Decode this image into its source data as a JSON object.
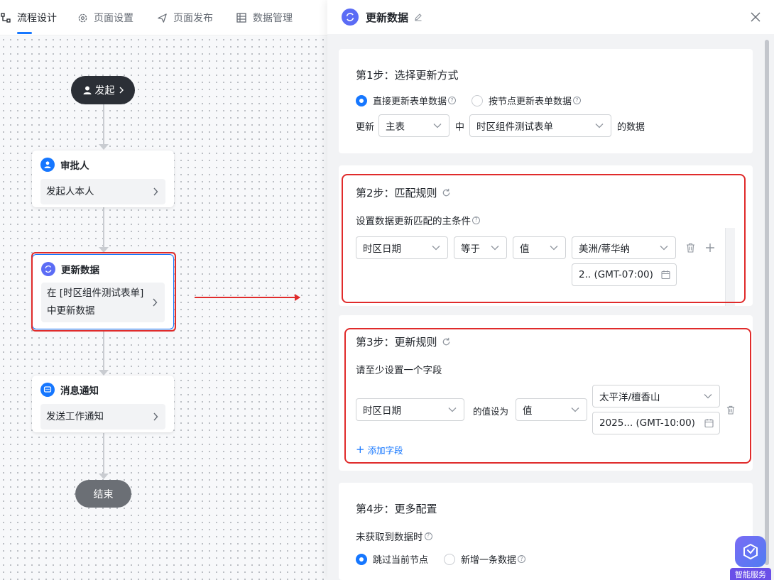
{
  "tabs": [
    {
      "label": "流程设计",
      "icon": "flow-icon",
      "active": true
    },
    {
      "label": "页面设置",
      "icon": "gear-icon",
      "active": false
    },
    {
      "label": "页面发布",
      "icon": "send-icon",
      "active": false
    },
    {
      "label": "数据管理",
      "icon": "table-icon",
      "active": false
    }
  ],
  "flow": {
    "start_label": "发起",
    "end_label": "结束",
    "nodes": [
      {
        "title": "审批人",
        "body": "发起人本人"
      },
      {
        "title": "更新数据",
        "body_line1": "在 [时区组件测试表单]",
        "body_line2": "中更新数据"
      },
      {
        "title": "消息通知",
        "body": "发送工作通知"
      }
    ]
  },
  "panel": {
    "title": "更新数据",
    "step1": {
      "title": "第1步：选择更新方式",
      "option_direct": "直接更新表单数据",
      "option_by_node": "按节点更新表单数据",
      "prefix": "更新",
      "table_select": "主表",
      "middle": "中",
      "form_select": "时区组件测试表单",
      "suffix": "的数据"
    },
    "step2": {
      "title": "第2步：匹配规则",
      "subtitle": "设置数据更新匹配的主条件",
      "field": "时区日期",
      "operator": "等于",
      "value_type": "值",
      "timezone": "美洲/蒂华纳",
      "date_value": "2..  (GMT-07:00)"
    },
    "step3": {
      "title": "第3步：更新规则",
      "subtitle": "请至少设置一个字段",
      "field": "时区日期",
      "set_label": "的值设为",
      "value_type": "值",
      "timezone": "太平洋/檀香山",
      "date_value": "2025...  (GMT-10:00)",
      "add_field": "添加字段"
    },
    "step4": {
      "title": "第4步：更多配置",
      "subtitle": "未获取到数据时",
      "option_skip": "跳过当前节点",
      "option_add": "新增一条数据"
    }
  },
  "assistant_label": "智能服务",
  "colors": {
    "accent": "#1677ff",
    "highlight": "#e02b2b",
    "node_purple": "#5b6cf5"
  }
}
